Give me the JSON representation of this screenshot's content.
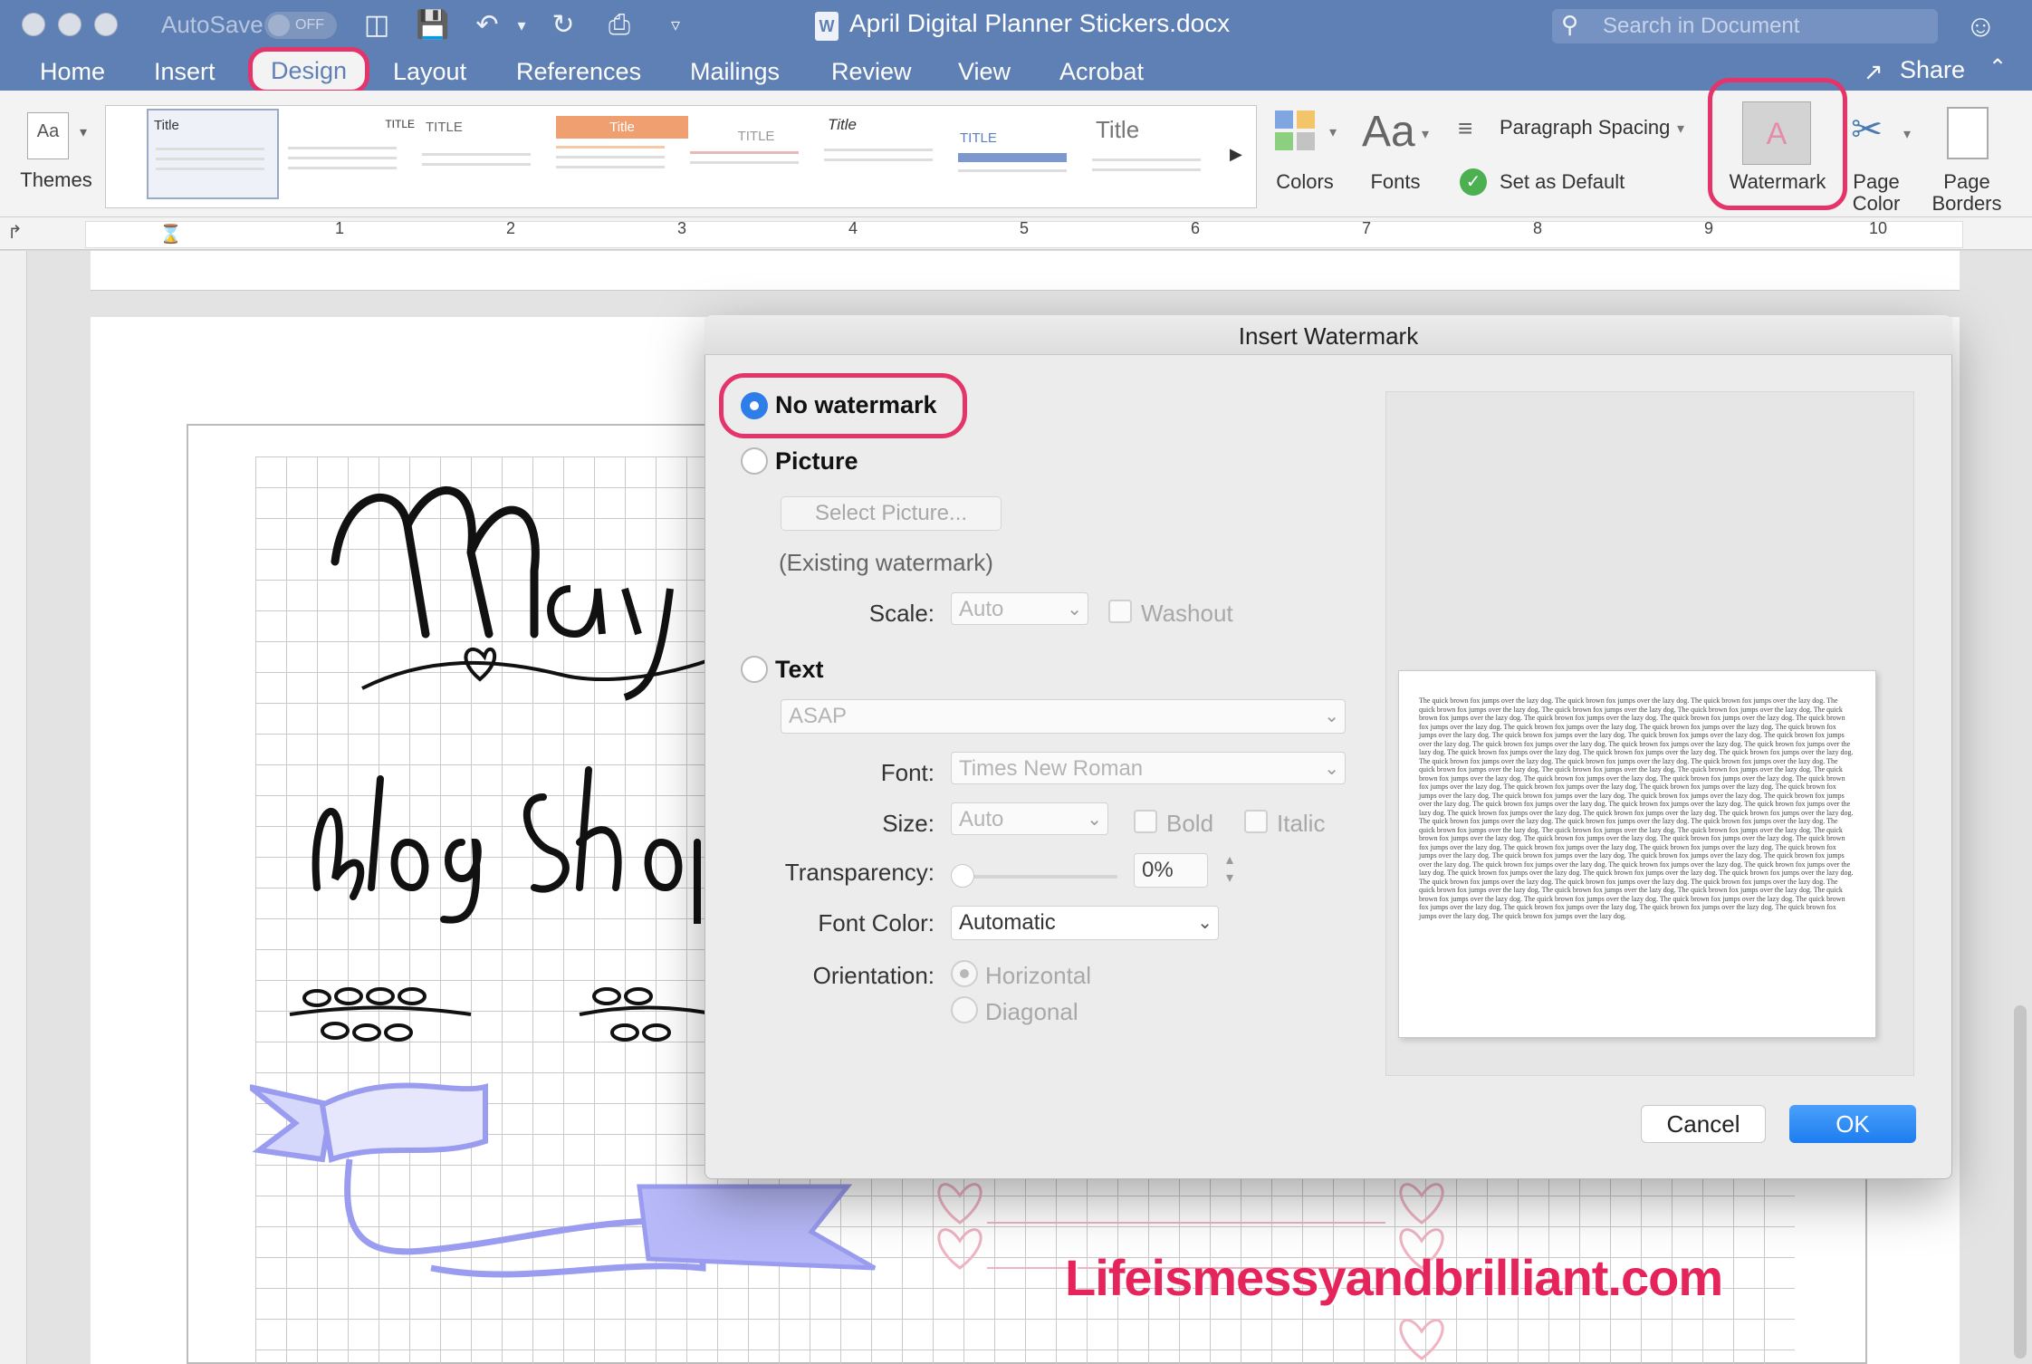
{
  "titlebar": {
    "autosave_label": "AutoSave",
    "autosave_state": "OFF",
    "doc_title": "April Digital Planner Stickers.docx",
    "search_placeholder": "Search in Document"
  },
  "tabs": [
    "Home",
    "Insert",
    "Design",
    "Layout",
    "References",
    "Mailings",
    "Review",
    "View",
    "Acrobat"
  ],
  "share_label": "Share",
  "ribbon": {
    "themes_label": "Themes",
    "gallery_titles": [
      "Title",
      "TITLE",
      "TITLE",
      "Title",
      "TITLE",
      "Title",
      "TITLE",
      "Title"
    ],
    "colors_label": "Colors",
    "fonts_label": "Fonts",
    "fonts_glyph": "Aa",
    "paragraph_spacing": "Paragraph Spacing",
    "set_as_default": "Set as Default",
    "watermark_label": "Watermark",
    "page_color_label_1": "Page",
    "page_color_label_2": "Color",
    "page_borders_label_1": "Page",
    "page_borders_label_2": "Borders"
  },
  "ruler_numbers": [
    "1",
    "2",
    "3",
    "4",
    "5",
    "6",
    "7",
    "8",
    "9",
    "10"
  ],
  "document": {
    "site_watermark": "Lifeismessyandbrilliant.com"
  },
  "dialog": {
    "title": "Insert Watermark",
    "no_watermark": "No watermark",
    "picture": "Picture",
    "select_picture": "Select Picture...",
    "existing_watermark": "(Existing watermark)",
    "scale_label": "Scale:",
    "scale_value": "Auto",
    "washout_label": "Washout",
    "text": "Text",
    "text_value": "ASAP",
    "font_label": "Font:",
    "font_value": "Times New Roman",
    "size_label": "Size:",
    "size_value": "Auto",
    "bold_label": "Bold",
    "italic_label": "Italic",
    "transparency_label": "Transparency:",
    "transparency_value": "0%",
    "font_color_label": "Font Color:",
    "font_color_value": "Automatic",
    "orientation_label": "Orientation:",
    "horizontal_label": "Horizontal",
    "diagonal_label": "Diagonal",
    "preview_sentence": "The quick brown fox jumps over the lazy dog.",
    "cancel_label": "Cancel",
    "ok_label": "OK"
  },
  "colors": {
    "title_bar": "#5f80b4",
    "highlight": "#e4346a",
    "accent_blue": "#2f7de9",
    "site_watermark": "#e4245a"
  }
}
